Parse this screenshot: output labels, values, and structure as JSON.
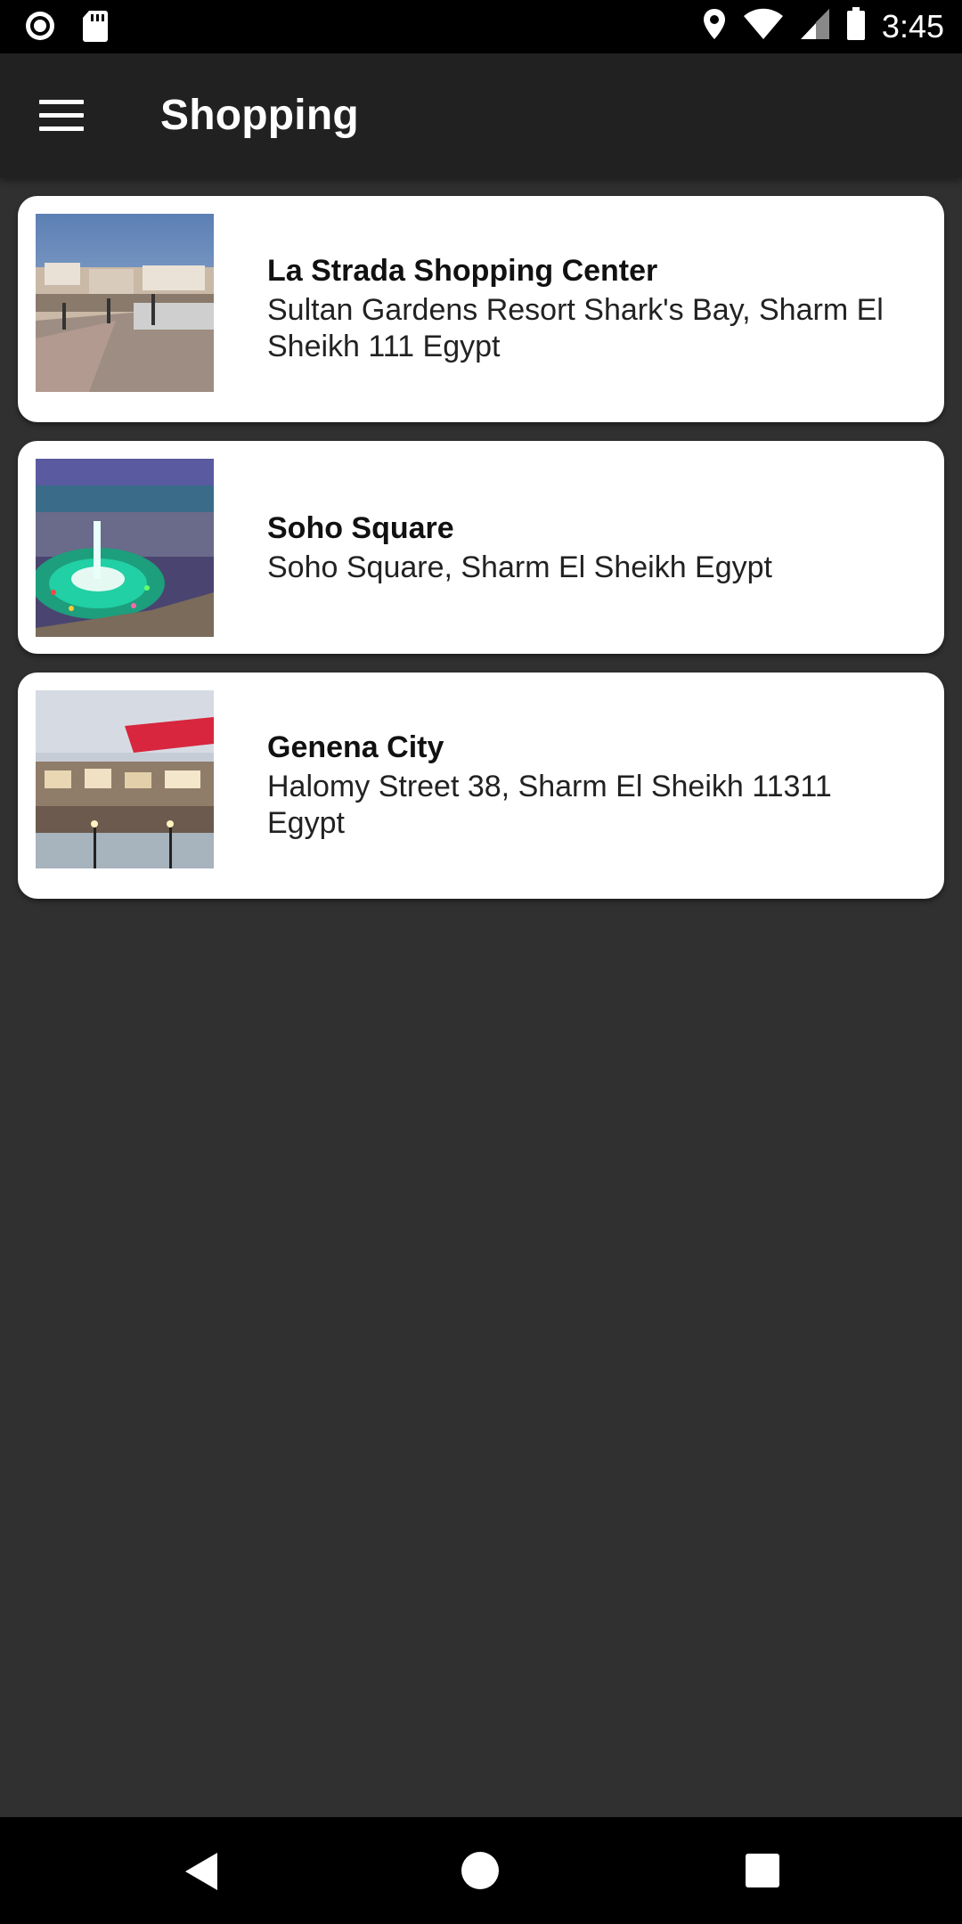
{
  "status_bar": {
    "time": "3:45",
    "left_icons": [
      "record-icon",
      "sd-card-icon"
    ],
    "right_icons": [
      "location-icon",
      "wifi-icon",
      "signal-icon",
      "battery-icon"
    ]
  },
  "app_bar": {
    "title": "Shopping",
    "menu_icon": "hamburger-menu-icon",
    "background": "#212121"
  },
  "places": [
    {
      "name": "La Strada Shopping Center",
      "address": "Sultan Gardens Resort Shark's Bay, Sharm El Sheikh 111 Egypt",
      "image": "promenade-photo"
    },
    {
      "name": "Soho Square",
      "address": "Soho Square, Sharm El Sheikh Egypt",
      "image": "fountain-plaza-photo"
    },
    {
      "name": "Genena City",
      "address": "Halomy Street 38, Sharm El Sheikh 11311 Egypt",
      "image": "shopping-mall-photo"
    }
  ],
  "colors": {
    "page_background": "#303030",
    "card_background": "#ffffff",
    "status_bar": "#000000",
    "nav_bar": "#000000"
  },
  "nav_bar": {
    "buttons": [
      "back-icon",
      "home-icon",
      "recents-icon"
    ]
  }
}
